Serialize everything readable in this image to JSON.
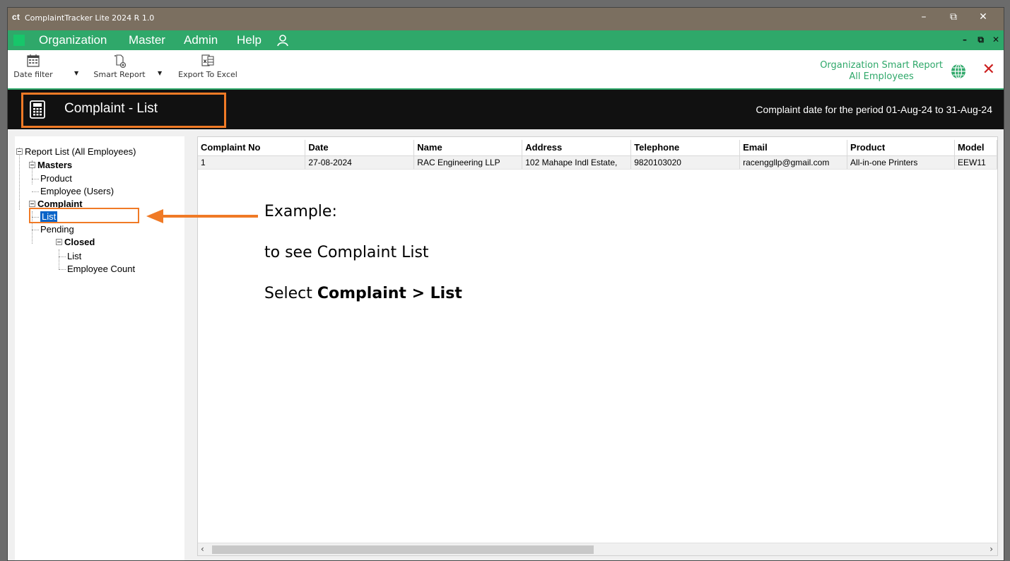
{
  "window": {
    "logo": "ct",
    "title": "ComplaintTracker Lite 2024 R 1.0"
  },
  "menubar": {
    "items": [
      "Organization",
      "Master",
      "Admin",
      "Help"
    ]
  },
  "toolbar": {
    "date_filter": "Date filter",
    "smart_report": "Smart Report",
    "export_excel": "Export To Excel",
    "smart_title_line1": "Organization Smart Report",
    "smart_title_line2": "All Employees"
  },
  "header": {
    "title": "Complaint - List",
    "period": "Complaint date for the period 01-Aug-24 to 31-Aug-24"
  },
  "tree": {
    "root": "Report List (All Employees)",
    "masters": "Masters",
    "product": "Product",
    "employee_users": "Employee (Users)",
    "complaint": "Complaint",
    "list": "List",
    "pending": "Pending",
    "closed": "Closed",
    "closed_list": "List",
    "employee_count": "Employee Count"
  },
  "grid": {
    "columns": [
      "Complaint No",
      "Date",
      "Name",
      "Address",
      "Telephone",
      "Email",
      "Product",
      "Model"
    ],
    "rows": [
      [
        "1",
        "27-08-2024",
        "RAC Engineering LLP",
        "102 Mahape Indl Estate,",
        "9820103020",
        "racenggllp@gmail.com",
        "All-in-one Printers",
        "EEW11"
      ]
    ]
  },
  "annotation": {
    "line1": "Example:",
    "line2": "to see Complaint List",
    "line3_prefix": "Select ",
    "line3_bold": "Complaint > List"
  },
  "colors": {
    "menu_green": "#2fa86a",
    "highlight_orange": "#f07a26",
    "header_black": "#111111",
    "selection_blue": "#0a64c8"
  }
}
